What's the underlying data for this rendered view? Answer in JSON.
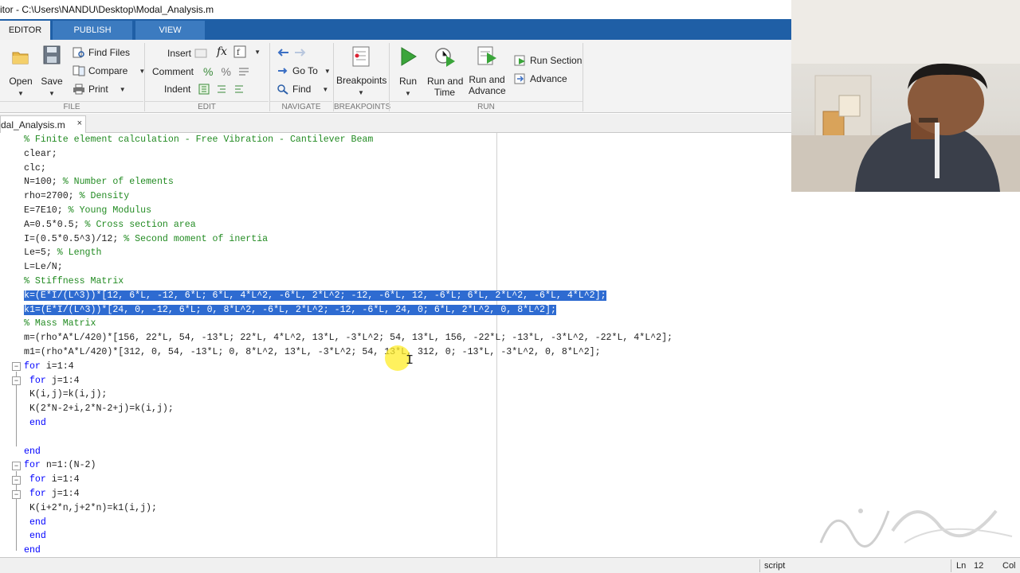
{
  "window": {
    "title": "itor - C:\\Users\\NANDU\\Desktop\\Modal_Analysis.m"
  },
  "tabs": [
    {
      "label": "EDITOR",
      "active": true
    },
    {
      "label": "PUBLISH",
      "active": false
    },
    {
      "label": "VIEW",
      "active": false
    }
  ],
  "ribbon": {
    "file": {
      "group_label": "FILE",
      "open": "Open",
      "save": "Save",
      "find_files": "Find Files",
      "compare": "Compare",
      "print": "Print"
    },
    "edit": {
      "group_label": "EDIT",
      "insert": "Insert",
      "comment": "Comment",
      "indent": "Indent",
      "fx": "fx"
    },
    "navigate": {
      "group_label": "NAVIGATE",
      "go_to": "Go To",
      "find": "Find"
    },
    "breakpoints": {
      "group_label": "BREAKPOINTS",
      "breakpoints": "Breakpoints"
    },
    "run": {
      "group_label": "RUN",
      "run": "Run",
      "run_and_time": [
        "Run and",
        "Time"
      ],
      "run_and_advance": [
        "Run and",
        "Advance"
      ],
      "run_section": "Run Section",
      "advance": "Advance"
    }
  },
  "file_tab": {
    "label": "dal_Analysis.m",
    "close": "×"
  },
  "code": {
    "lines": [
      {
        "segments": [
          {
            "t": "% Finite element calculation - Free Vibration - Cantilever Beam",
            "c": "cm"
          }
        ]
      },
      {
        "segments": [
          {
            "t": "clear;",
            "c": ""
          }
        ]
      },
      {
        "segments": [
          {
            "t": "clc;",
            "c": ""
          }
        ]
      },
      {
        "segments": [
          {
            "t": "N=100; ",
            "c": ""
          },
          {
            "t": "% Number of elements",
            "c": "cm"
          }
        ]
      },
      {
        "segments": [
          {
            "t": "rho=2700; ",
            "c": ""
          },
          {
            "t": "% Density",
            "c": "cm"
          }
        ]
      },
      {
        "segments": [
          {
            "t": "E=7E10; ",
            "c": ""
          },
          {
            "t": "% Young Modulus",
            "c": "cm"
          }
        ]
      },
      {
        "segments": [
          {
            "t": "A=0.5*0.5; ",
            "c": ""
          },
          {
            "t": "% Cross section area",
            "c": "cm"
          }
        ]
      },
      {
        "segments": [
          {
            "t": "I=(0.5*0.5^3)/12; ",
            "c": ""
          },
          {
            "t": "% Second moment of inertia",
            "c": "cm"
          }
        ]
      },
      {
        "segments": [
          {
            "t": "Le=5; ",
            "c": ""
          },
          {
            "t": "% Length",
            "c": "cm"
          }
        ]
      },
      {
        "segments": [
          {
            "t": "L=Le/N;",
            "c": ""
          }
        ]
      },
      {
        "segments": [
          {
            "t": "% Stiffness Matrix",
            "c": "cm"
          }
        ]
      },
      {
        "segments": [
          {
            "t": "k=(E*I/(L^3))*[12, 6*L, -12, 6*L; 6*L, 4*L^2, -6*L, 2*L^2; -12, -6*L, 12, -6*L; 6*L, 2*L^2, -6*L, 4*L^2];",
            "c": "sel"
          }
        ]
      },
      {
        "segments": [
          {
            "t": "k1=(E*I/(L^3))*[24, 0, -12, 6*L; 0, 8*L^2, -6*L, 2*L^2; -12, -6*L, 24, 0; 6*L, 2*L^2, 0, 8*L^2];",
            "c": "sel"
          }
        ]
      },
      {
        "segments": [
          {
            "t": "% Mass Matrix",
            "c": "cm"
          }
        ]
      },
      {
        "segments": [
          {
            "t": "m=(rho*A*L/420)*[156, 22*L, 54, -13*L; 22*L, 4*L^2, 13*L, -3*L^2; 54, 13*L, 156, -22*L; -13*L, -3*L^2, -22*L, 4*L^2];",
            "c": ""
          }
        ]
      },
      {
        "segments": [
          {
            "t": "m1=(rho*A*L/420)*[312, 0, 54, -13*L; 0, 8*L^2, 13*L, -3*L^2; 54, 13*L, 312, 0; -13*L, -3*L^2, 0, 8*L^2];",
            "c": ""
          }
        ]
      },
      {
        "segments": [
          {
            "t": "for",
            "c": "kw"
          },
          {
            "t": " i=1:4",
            "c": ""
          }
        ]
      },
      {
        "segments": [
          {
            "t": " ",
            "c": ""
          },
          {
            "t": "for",
            "c": "kw"
          },
          {
            "t": " j=1:4",
            "c": ""
          }
        ]
      },
      {
        "segments": [
          {
            "t": " K(i,j)=k(i,j);",
            "c": ""
          }
        ]
      },
      {
        "segments": [
          {
            "t": " K(2*N-2+i,2*N-2+j)=k(i,j);",
            "c": ""
          }
        ]
      },
      {
        "segments": [
          {
            "t": " ",
            "c": ""
          },
          {
            "t": "end",
            "c": "kw"
          }
        ]
      },
      {
        "segments": [
          {
            "t": "",
            "c": ""
          }
        ]
      },
      {
        "segments": [
          {
            "t": "end",
            "c": "kw"
          }
        ]
      },
      {
        "segments": [
          {
            "t": "for",
            "c": "kw"
          },
          {
            "t": " n=1:(N-2)",
            "c": ""
          }
        ]
      },
      {
        "segments": [
          {
            "t": " ",
            "c": ""
          },
          {
            "t": "for",
            "c": "kw"
          },
          {
            "t": " i=1:4",
            "c": ""
          }
        ]
      },
      {
        "segments": [
          {
            "t": " ",
            "c": ""
          },
          {
            "t": "for",
            "c": "kw"
          },
          {
            "t": " j=1:4",
            "c": ""
          }
        ]
      },
      {
        "segments": [
          {
            "t": " K(i+2*n,j+2*n)=k1(i,j);",
            "c": ""
          }
        ]
      },
      {
        "segments": [
          {
            "t": " ",
            "c": ""
          },
          {
            "t": "end",
            "c": "kw"
          }
        ]
      },
      {
        "segments": [
          {
            "t": " ",
            "c": ""
          },
          {
            "t": "end",
            "c": "kw"
          }
        ]
      },
      {
        "segments": [
          {
            "t": "end",
            "c": "kw"
          }
        ]
      }
    ]
  },
  "status": {
    "mode": "script",
    "ln_label": "Ln",
    "ln_value": "12",
    "col_label": "Col"
  },
  "colors": {
    "ribbon_tab_bar": "#1f5fa6",
    "selection": "#2e6bd1",
    "keyword": "#0000ff",
    "comment": "#228b22",
    "run_green": "#3aa53a",
    "cursor_highlight": "#ffec28"
  },
  "icons": [
    "open-folder-icon",
    "save-disk-icon",
    "find-files-icon",
    "compare-icon",
    "print-icon",
    "insert-icon",
    "fx-icon",
    "comment-icon",
    "indent-icon",
    "back-arrow-icon",
    "forward-arrow-icon",
    "goto-icon",
    "find-icon",
    "breakpoints-icon",
    "run-icon",
    "run-and-time-icon",
    "run-and-advance-icon",
    "run-section-icon",
    "advance-icon"
  ]
}
